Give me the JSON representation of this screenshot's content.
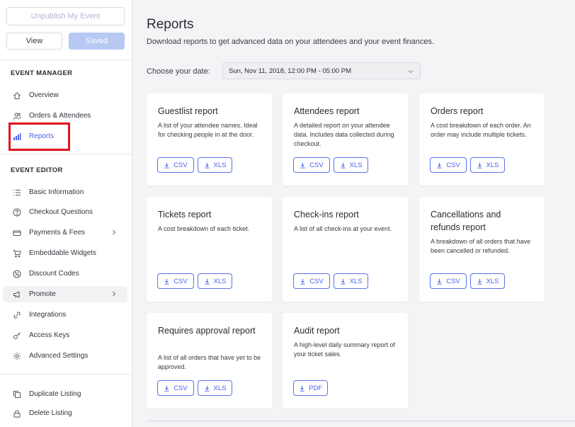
{
  "sidebar": {
    "unpublish_label": "Unpublish My Event",
    "view_label": "View",
    "saved_label": "Saved",
    "event_manager_heading": "EVENT MANAGER",
    "event_manager_items": [
      {
        "label": "Overview",
        "icon": "home-icon"
      },
      {
        "label": "Orders & Attendees",
        "icon": "users-icon"
      },
      {
        "label": "Reports",
        "icon": "bar-chart-icon",
        "active": true
      }
    ],
    "event_editor_heading": "EVENT EDITOR",
    "event_editor_items": [
      {
        "label": "Basic Information",
        "icon": "list-icon"
      },
      {
        "label": "Checkout Questions",
        "icon": "question-icon"
      },
      {
        "label": "Payments & Fees",
        "icon": "payment-icon",
        "has_submenu": true
      },
      {
        "label": "Embeddable Widgets",
        "icon": "cart-icon"
      },
      {
        "label": "Discount Codes",
        "icon": "discount-icon"
      },
      {
        "label": "Promote",
        "icon": "megaphone-icon",
        "has_submenu": true
      },
      {
        "label": "Integrations",
        "icon": "link-icon"
      },
      {
        "label": "Access Keys",
        "icon": "key-icon"
      },
      {
        "label": "Advanced Settings",
        "icon": "gear-icon"
      }
    ],
    "bottom_items": [
      {
        "label": "Duplicate Listing",
        "icon": "duplicate-icon"
      },
      {
        "label": "Delete Listing",
        "icon": "lock-icon"
      }
    ]
  },
  "main": {
    "title": "Reports",
    "subtitle": "Download reports to get advanced data on your attendees and your event finances.",
    "date_label": "Choose your date:",
    "date_value": "Sun, Nov 11, 2018, 12:00 PM - 05:00 PM",
    "cards": [
      {
        "title": "Guestlist report",
        "description": "A list of your attendee names. Ideal for checking people in at the door.",
        "buttons": [
          "CSV",
          "XLS"
        ]
      },
      {
        "title": "Attendees report",
        "description": "A detailed report on your attendee data. Includes data collected during checkout.",
        "buttons": [
          "CSV",
          "XLS"
        ]
      },
      {
        "title": "Orders report",
        "description": "A cost breakdown of each order. An order may include multiple tickets.",
        "buttons": [
          "CSV",
          "XLS"
        ]
      },
      {
        "title": "Tickets report",
        "description": "A cost breakdown of each ticket.",
        "buttons": [
          "CSV",
          "XLS"
        ]
      },
      {
        "title": "Check-ins report",
        "description": "A list of all check-ins at your event.",
        "buttons": [
          "CSV",
          "XLS"
        ]
      },
      {
        "title": "Cancellations and refunds report",
        "description": "A breakdown of all orders that have been cancelled or refunded.",
        "buttons": [
          "CSV",
          "XLS"
        ]
      },
      {
        "title": "Requires approval report",
        "description": "A list of all orders that have yet to be approved.",
        "buttons": [
          "CSV",
          "XLS"
        ]
      },
      {
        "title": "Audit report",
        "description": "A high-level daily summary report of your ticket sales.",
        "buttons": [
          "PDF"
        ]
      }
    ]
  },
  "colors": {
    "accent": "#4a63e7",
    "highlight_border": "#e0141e",
    "saved_button": "#b7c8f3"
  }
}
